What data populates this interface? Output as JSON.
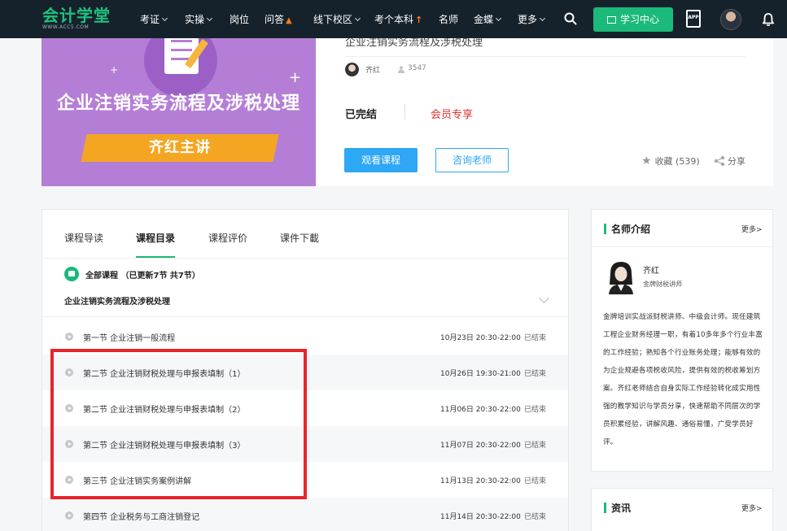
{
  "nav": {
    "logo_text": "会计学堂",
    "logo_url_text": "WWW.ACC5.COM",
    "items": [
      {
        "label": "考证",
        "caret": true
      },
      {
        "label": "实操",
        "caret": true
      },
      {
        "label": "岗位",
        "caret": false
      },
      {
        "label": "问答",
        "caret": false
      },
      {
        "label": "线下校区",
        "caret": true
      },
      {
        "label": "考个本科",
        "caret": false
      },
      {
        "label": "名师",
        "caret": false
      },
      {
        "label": "金蝶",
        "caret": true
      },
      {
        "label": "更多",
        "caret": true
      }
    ],
    "study_center": "学习中心",
    "app_label": "APP"
  },
  "course": {
    "cover_title": "企业注销实务流程及涉税处理",
    "cover_teacher": "齐红主讲",
    "title": "企业注销实务流程及涉税处理",
    "teacher": "齐红",
    "learners": "3547",
    "status": "已完结",
    "member": "会员专享",
    "watch_btn": "观看课程",
    "consult_btn": "咨询老师",
    "favorite": "收藏 (539)",
    "share": "分享"
  },
  "tabs": [
    {
      "label": "课程导读",
      "active": false
    },
    {
      "label": "课程目录",
      "active": true
    },
    {
      "label": "课程评价",
      "active": false
    },
    {
      "label": "课件下載",
      "active": false
    }
  ],
  "catalog": {
    "all_label": "全部课程 （已更新7节 共7节）",
    "section_title": "企业注销实务流程及涉税处理",
    "lessons": [
      {
        "title": "第一节 企业注销一般流程",
        "time": "10月23日 20:30-22:00",
        "status": "已结束"
      },
      {
        "title": "第二节 企业注销财税处理与申报表填制（1）",
        "time": "10月26日 19:30-21:00",
        "status": "已结束"
      },
      {
        "title": "第二节 企业注销财税处理与申报表填制（2）",
        "time": "11月06日 20:30-22:00",
        "status": "已结束"
      },
      {
        "title": "第二节 企业注销财税处理与申报表填制（3）",
        "time": "11月07日 20:30-22:00",
        "status": "已结束"
      },
      {
        "title": "第三节 企业注销实务案例讲解",
        "time": "11月13日 20:30-22:00",
        "status": "已结束"
      },
      {
        "title": "第四节 企业税务与工商注销登记",
        "time": "11月14日 20:30-22:00",
        "status": "已结束"
      }
    ]
  },
  "teacher_panel": {
    "heading": "名师介绍",
    "more": "更多>",
    "name": "齐红",
    "role": "金牌财税讲师",
    "desc": "金牌培训实战派财税讲师、中级会计师。现任建筑工程企业财务经理一职，有着10多年多个行业丰富的工作经验；熟知各个行业账务处理；能够有效的为企业规避各项税收风险，提供有效的税收筹划方案。齐红老师结合自身实际工作经验转化成实用性强的教学知识与学员分享，快速帮助不同层次的学员积累经验，讲解风趣、通俗易懂，广受学员好评。"
  },
  "news_panel": {
    "heading": "资讯",
    "more": "更多>"
  },
  "colors": {
    "nav_bg": "#16222b",
    "accent_green": "#1bb97a",
    "button_blue": "#2ea7f4",
    "member_red": "#e0312e",
    "highlight_red": "#e8242a"
  }
}
